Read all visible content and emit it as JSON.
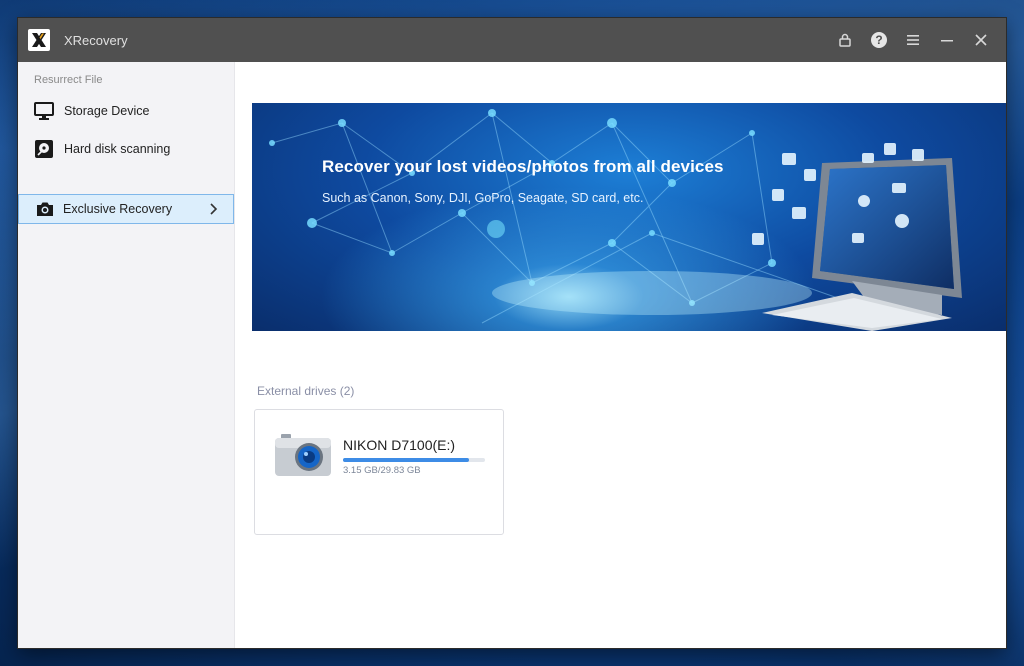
{
  "app": {
    "title": "XRecovery"
  },
  "titlebar": {
    "icons": [
      "lock-icon",
      "help-icon",
      "menu-icon",
      "minimize-icon",
      "close-icon"
    ]
  },
  "sidebar": {
    "heading": "Resurrect File",
    "items": [
      {
        "label": "Storage Device",
        "icon": "monitor-icon"
      },
      {
        "label": "Hard disk scanning",
        "icon": "hard-disk-icon"
      }
    ],
    "exclusive": {
      "label": "Exclusive Recovery",
      "icon": "camera-icon"
    }
  },
  "banner": {
    "title": "Recover your lost videos/photos from all devices",
    "subtitle": "Such as Canon, Sony, DJI, GoPro, Seagate, SD card, etc."
  },
  "drives": {
    "section_label": "External drives (2)",
    "items": [
      {
        "name": "NIKON D7100(E:)",
        "size": "3.15 GB/29.83 GB",
        "usage_fraction": 0.89,
        "icon": "camera-drive-icon"
      }
    ]
  },
  "colors": {
    "titlebar": "#505050",
    "accent": "#3d8ce6",
    "active_bg": "#dceefc",
    "active_border": "#7fb7ea"
  }
}
